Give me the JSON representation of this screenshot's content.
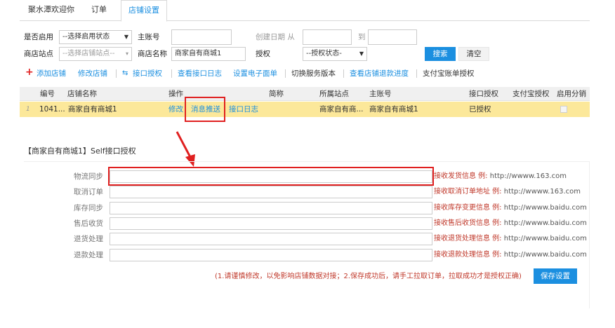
{
  "tabs": [
    "聚水潭欢迎你",
    "订单",
    "店铺设置"
  ],
  "filters": {
    "enable_label": "是否启用",
    "enable_select": "--选择启用状态",
    "main_account_label": "主账号",
    "main_account_value": "",
    "created_date_label": "创建日期 从",
    "created_to_label": "到",
    "site_label": "商店站点",
    "site_select": "--选择店铺站点--",
    "shop_name_label": "商店名称",
    "shop_name_value": "商家自有商城1",
    "auth_label": "授权",
    "auth_select": "--授权状态-",
    "search_button": "搜索",
    "clear_button": "清空"
  },
  "toolbar": {
    "add_shop": "添加店铺",
    "edit_shop": "修改店铺",
    "authorize": "接口授权",
    "view_log": "查看接口日志",
    "e_waybill": "设置电子面单",
    "switch_version": "切换服务版本",
    "refund_progress": "查看店铺退款进度",
    "alipay_auth": "支付宝账单授权"
  },
  "table": {
    "headers": [
      "编号",
      "店铺名称",
      "操作",
      "简称",
      "所属站点",
      "主账号",
      "接口授权",
      "支付宝授权",
      "启用分销"
    ],
    "row": {
      "index": "1",
      "id": "1041...",
      "name": "商家自有商城1",
      "op_edit": "修改",
      "op_push": "消息推送",
      "op_log": "接口日志",
      "site": "商家自有商...",
      "main_account": "商家自有商城1",
      "auth_status": "已授权"
    }
  },
  "section": {
    "title": "【商家自有商城1】Self接口授权",
    "fields": [
      {
        "label": "物流同步",
        "value": "",
        "hint": "接收发货信息 例:",
        "url": "http://wwww.163.com"
      },
      {
        "label": "取消订单",
        "value": "",
        "hint": "接收取消订单地址 例:",
        "url": "http://wwww.163.com"
      },
      {
        "label": "库存同步",
        "value": "",
        "hint": "接收库存变更信息 例:",
        "url": "http://wwww.baidu.com"
      },
      {
        "label": "售后收货",
        "value": "",
        "hint": "接收售后收货信息 例:",
        "url": "http://wwww.baidu.com"
      },
      {
        "label": "退货处理",
        "value": "",
        "hint": "接收退货处理信息 例:",
        "url": "http://wwww.baidu.com"
      },
      {
        "label": "退款处理",
        "value": "",
        "hint": "接收退款处理信息 例:",
        "url": "http://wwww.baidu.com"
      }
    ],
    "note": "(1.请谨慎修改，以免影响店铺数据对接；2.保存成功后，请手工拉取订单，拉取成功才是授权正确)",
    "save_button": "保存设置"
  },
  "colors": {
    "accent": "#1b8fe0",
    "highlight_row": "#fce89a",
    "annotation_red": "#e02020"
  }
}
